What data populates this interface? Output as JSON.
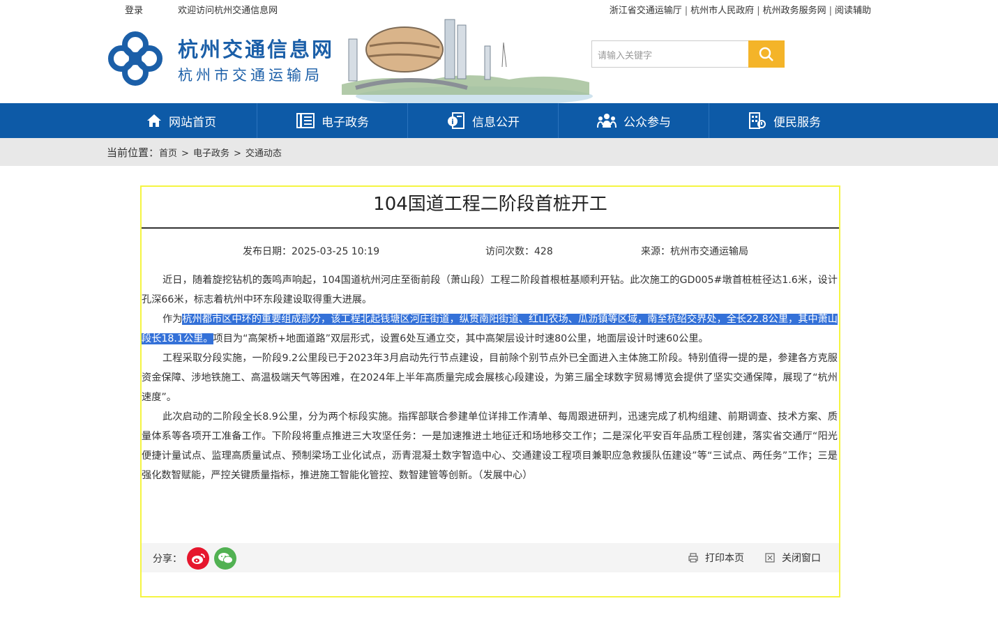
{
  "topbar": {
    "login": "登录",
    "welcome": "欢迎访问杭州交通信息网",
    "links": [
      "浙江省交通运输厅",
      "杭州市人民政府",
      "杭州政务服务网",
      "阅读辅助"
    ],
    "sep": "|"
  },
  "header": {
    "site_name": "杭州交通信息网",
    "site_sub": "杭州市交通运输局",
    "search_placeholder": "请输入关键字"
  },
  "nav": {
    "items": [
      {
        "label": "网站首页",
        "icon": "home-icon"
      },
      {
        "label": "电子政务",
        "icon": "book-icon"
      },
      {
        "label": "信息公开",
        "icon": "info-doc-icon"
      },
      {
        "label": "公众参与",
        "icon": "people-icon"
      },
      {
        "label": "便民服务",
        "icon": "building-icon"
      }
    ]
  },
  "breadcrumb": {
    "label": "当前位置：",
    "items": [
      "首页",
      "电子政务",
      "交通动态"
    ],
    "sep": ">"
  },
  "article": {
    "title": "104国道工程二阶段首桩开工",
    "date": "发布日期：2025-03-25 10:19",
    "visits": "访问次数：428",
    "source": "来源：杭州市交通运输局",
    "p1": "近日，随着旋挖钻机的轰鸣声响起，104国道杭州河庄至衙前段（萧山段）工程二阶段首根桩基顺利开钻。此次施工的GD005#墩首桩桩径达1.6米，设计孔深66米，标志着杭州中环东段建设取得重大进展。",
    "p2_pre": "作为",
    "p2_hl": "杭州都市区中环的重要组成部分，该工程北起钱塘区河庄街道，纵贯南阳街道、红山农场、瓜沥镇等区域，南至杭绍交界处，全长22.8公里，其中萧山段长18.1公里。",
    "p2_post": "项目为“高架桥+地面道路”双层形式，设置6处互通立交，其中高架层设计时速80公里，地面层设计时速60公里。",
    "p3": "工程采取分段实施，一阶段9.2公里段已于2023年3月启动先行节点建设，目前除个别节点外已全面进入主体施工阶段。特别值得一提的是，参建各方克服资金保障、涉地铁施工、高温极端天气等困难，在2024年上半年高质量完成会展核心段建设，为第三届全球数字贸易博览会提供了坚实交通保障，展现了“杭州速度”。",
    "p4": "此次启动的二阶段全长8.9公里，分为两个标段实施。指挥部联合参建单位详排工作清单、每周跟进研判，迅速完成了机构组建、前期调查、技术方案、质量体系等各项开工准备工作。下阶段将重点推进三大攻坚任务：一是加速推进土地征迁和场地移交工作；二是深化平安百年品质工程创建，落实省交通厅“阳光便捷计量试点、监理高质量试点、预制梁场工业化试点，沥青混凝土数字智造中心、交通建设工程项目兼职应急救援队伍建设”等“三试点、两任务”工作；三是强化数智赋能，严控关键质量指标，推进施工智能化管控、数智建管等创新。（发展中心）"
  },
  "share": {
    "label": "分享：",
    "print": "打印本页",
    "close": "关闭窗口"
  },
  "colors": {
    "brand_blue": "#0d5aa7",
    "search_yellow": "#f4b429",
    "highlight": "#3471d8",
    "weibo_red": "#e6162d",
    "wechat_green": "#51b152"
  }
}
